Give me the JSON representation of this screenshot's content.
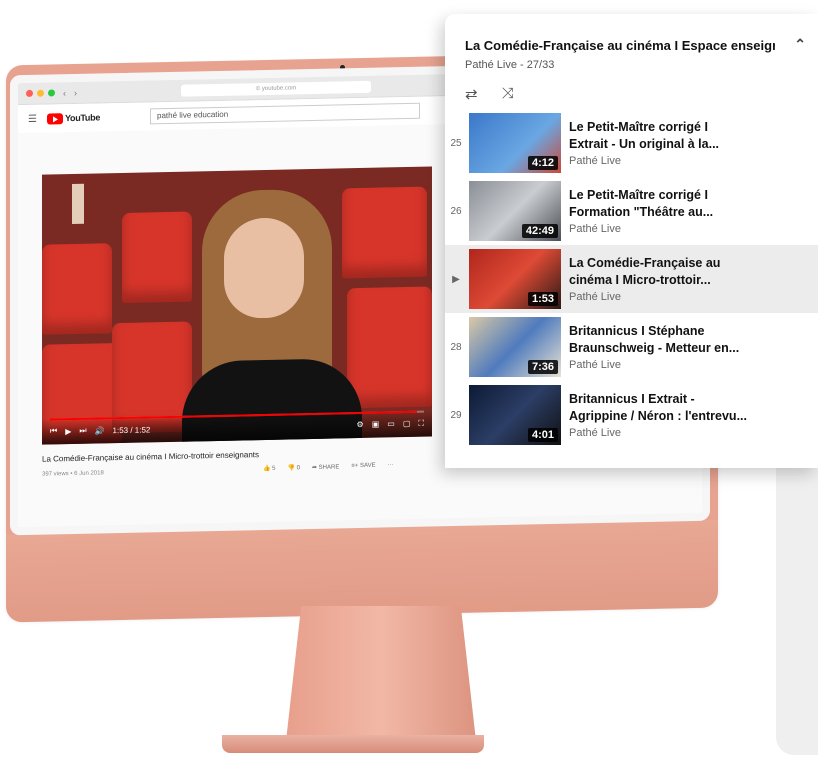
{
  "browser": {
    "url": "© youtube.com",
    "nav_left": "‹",
    "nav_right": "›"
  },
  "youtube": {
    "logo_text": "YouTube",
    "search_value": "pathé live education",
    "video": {
      "time": "1:53 / 1:52",
      "title": "La Comédie-Française au cinéma I Micro-trottoir enseignants",
      "meta": "397 views • 6 Jun 2018",
      "like": "5",
      "dislike": "0",
      "share": "SHARE",
      "save": "SAVE",
      "more": "···",
      "progress_percent": 98
    }
  },
  "playlist": {
    "title": "La Comédie-Française au cinéma I Espace enseignar",
    "channel": "Pathé Live",
    "position": "27/33",
    "collapse_icon": "chevron-up-icon",
    "loop_icon": "loop-icon",
    "shuffle_icon": "shuffle-icon",
    "items": [
      {
        "index": "25",
        "title_line1": "Le Petit-Maître corrigé I",
        "title_line2": "Extrait - Un original à la...",
        "channel": "Pathé Live",
        "duration": "4:12",
        "active": false
      },
      {
        "index": "26",
        "title_line1": "Le Petit-Maître corrigé I",
        "title_line2": "Formation \"Théâtre au...",
        "channel": "Pathé Live",
        "duration": "42:49",
        "active": false
      },
      {
        "index": "▶",
        "title_line1": "La Comédie-Française au",
        "title_line2": "cinéma I Micro-trottoir...",
        "channel": "Pathé Live",
        "duration": "1:53",
        "active": true
      },
      {
        "index": "28",
        "title_line1": "Britannicus I Stéphane",
        "title_line2": "Braunschweig - Metteur en...",
        "channel": "Pathé Live",
        "duration": "7:36",
        "active": false
      },
      {
        "index": "29",
        "title_line1": "Britannicus I Extrait -",
        "title_line2": "Agrippine / Néron : l'entrevu...",
        "channel": "Pathé Live",
        "duration": "4:01",
        "active": false
      }
    ]
  },
  "colors": {
    "imac": "#e7a290",
    "youtube_red": "#ff0000",
    "seat_red": "#d8352a"
  }
}
